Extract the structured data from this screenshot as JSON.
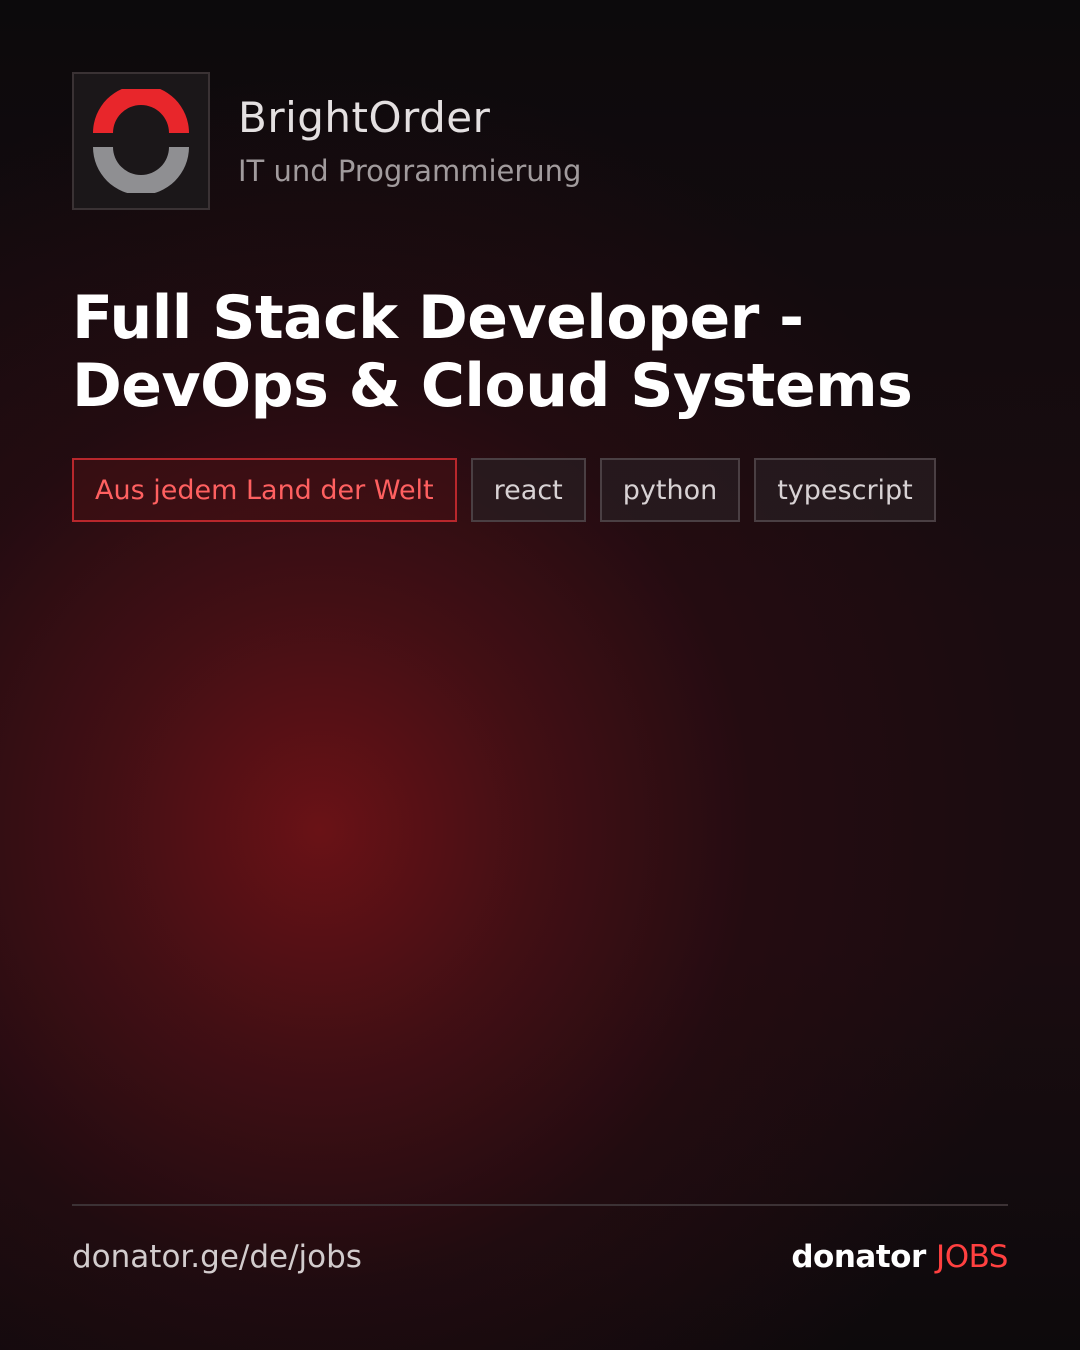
{
  "company": {
    "name": "BrightOrder",
    "category": "IT und Programmierung",
    "logo_icon": "ring-logo-icon"
  },
  "job": {
    "title": "Full Stack Developer - DevOps & Cloud Systems"
  },
  "tags": {
    "location": "Aus jedem Land der Welt",
    "skills": [
      "react",
      "python",
      "typescript"
    ]
  },
  "footer": {
    "url": "donator.ge/de/jobs",
    "brand_main": "donator",
    "brand_accent": "JOBS"
  },
  "colors": {
    "accent": "#e8262b",
    "logo_gray": "#8f8f92",
    "tag_location": "#ff6060"
  }
}
